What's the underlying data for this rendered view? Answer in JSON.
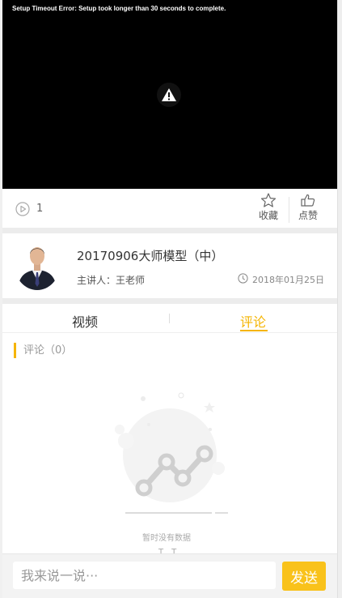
{
  "video": {
    "error_text": "Setup Timeout Error: Setup took longer than 30 seconds to complete.",
    "status_icon": "warning-icon"
  },
  "stats": {
    "play_icon": "play-circle-icon",
    "play_count": "1",
    "favorite_icon": "star-icon",
    "favorite_label": "收藏",
    "like_icon": "thumbs-up-icon",
    "like_label": "点赞"
  },
  "course": {
    "title": "20170906大师模型（中）",
    "speaker": "主讲人：王老师",
    "date_icon": "clock-icon",
    "date": "2018年01月25日"
  },
  "tabs": [
    {
      "label": "视频",
      "active": false
    },
    {
      "label": "评论",
      "active": true
    }
  ],
  "comments": {
    "header": "评论（0）",
    "empty_icon": "empty-chart-icon",
    "empty_text": "暂时没有数据",
    "empty_face": "T﹏T"
  },
  "composer": {
    "placeholder": "我来说一说···",
    "value": "",
    "send_label": "发送"
  },
  "colors": {
    "accent": "#f5b400",
    "send_button": "#f9c21b",
    "video_bg": "#000000",
    "section_gap": "#ececec"
  }
}
